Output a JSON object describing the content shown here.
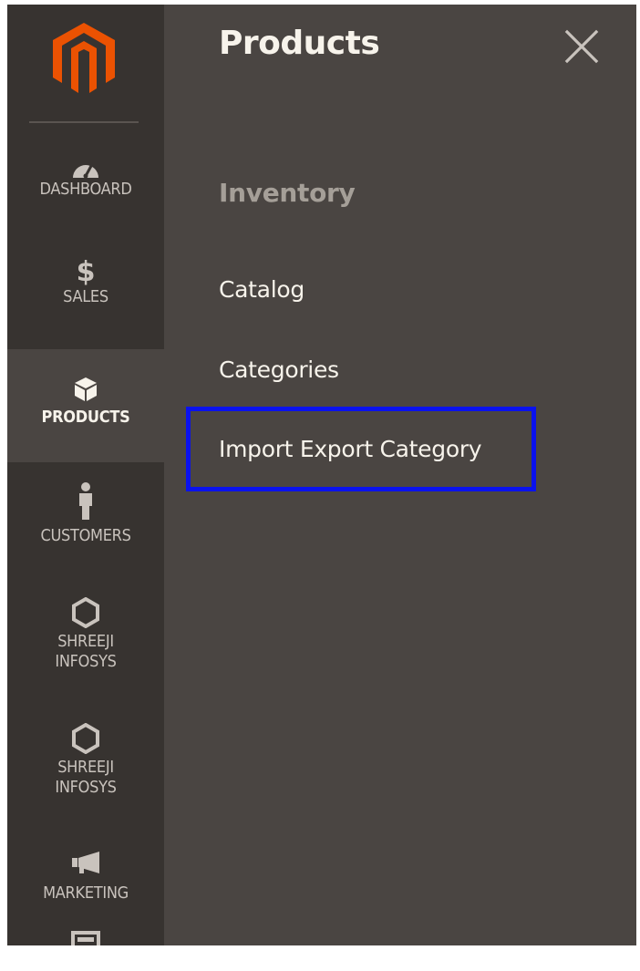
{
  "sidebar": {
    "items": [
      {
        "label": "DASHBOARD",
        "icon": "dashboard-gauge-icon"
      },
      {
        "label": "$",
        "icon": "dollar-icon"
      },
      {
        "label": "SALES"
      },
      {
        "label": "PRODUCTS",
        "icon": "cube-icon",
        "active": true
      },
      {
        "label": "CUSTOMERS",
        "icon": "person-icon"
      },
      {
        "label": "SHREEJI",
        "icon": "hexagon-icon"
      },
      {
        "label": "INFOSYS"
      },
      {
        "label": "SHREEJI",
        "icon": "hexagon-icon"
      },
      {
        "label": "INFOSYS"
      },
      {
        "label": "MARKETING",
        "icon": "megaphone-icon"
      }
    ]
  },
  "panel": {
    "title": "Products",
    "section": "Inventory",
    "links": [
      "Catalog",
      "Categories",
      "Import Export Category"
    ]
  },
  "colors": {
    "sidebar_bg": "#373330",
    "panel_bg": "#4a4542",
    "brand_orange": "#eb5202",
    "highlight_border": "#0a12ee",
    "text_light": "#f7f3eb",
    "text_muted": "#a59f98"
  }
}
